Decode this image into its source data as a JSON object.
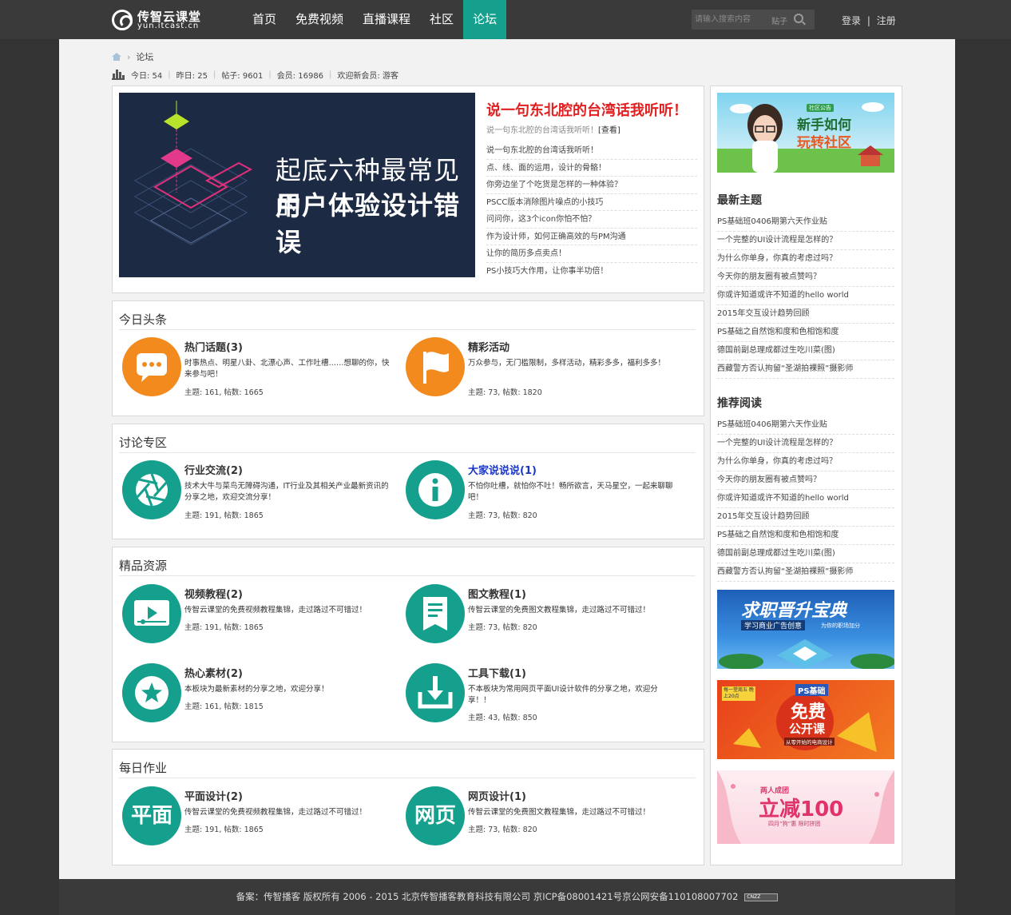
{
  "header": {
    "logo_cn": "传智云课堂",
    "logo_en": "yun.itcast.cn",
    "nav": [
      "首页",
      "免费视频",
      "直播课程",
      "社区",
      "论坛"
    ],
    "search_placeholder": "请输入搜索内容",
    "search_category": "贴子",
    "login": "登录",
    "divider": "|",
    "register": "注册"
  },
  "breadcrumb": {
    "current": "论坛"
  },
  "stats": {
    "today": "今日: 54",
    "yesterday": "昨日: 25",
    "posts": "帖子: 9601",
    "members": "会员: 16986",
    "welcome": "欢迎新会员: 游客"
  },
  "featured": {
    "banner_line1": "起底六种最常见的",
    "banner_line2": "用户体验设计错误",
    "headline": "说一句东北腔的台湾话我听听！",
    "subline": "说一句东北腔的台湾话我听听！",
    "subline_link": "[查看]",
    "items": [
      "说一句东北腔的台湾话我听听！",
      "点、线、面的运用，设计的骨骼！",
      "你旁边坐了个吃货是怎样的一种体验？",
      "PSCC版本消除图片噪点的小技巧",
      "问问你，这3个icon你怕不怕？",
      "作为设计师，如何正确高效的与PM沟通",
      "让你的简历多点卖点！",
      "PS小技巧大作用，让你事半功倍！"
    ]
  },
  "sections": {
    "headlines": {
      "title": "今日头条",
      "forums": [
        {
          "name": "热门话题(3)",
          "desc": "时事热点、明星八卦、北漂心声、工作吐槽……想聊的你，快来参与吧！",
          "count": "主题: 161, 帖数: 1665"
        },
        {
          "name": "精彩活动",
          "desc": "万众参与，无门槛限制，多样活动，精彩多多，福利多多！",
          "count": "主题: 73, 帖数: 1820"
        }
      ]
    },
    "discussion": {
      "title": "讨论专区",
      "forums": [
        {
          "name": "行业交流(2)",
          "desc": "技术大牛与菜鸟无障碍沟通，IT行业及其相关产业最新资讯的分享之地，欢迎交流分享！",
          "count": "主题: 191, 帖数: 1865"
        },
        {
          "name": "大家说说说(1)",
          "desc": "不怕你吐槽，就怕你不吐！畅所欲言，天马星空，一起来聊聊吧！",
          "count": "主题: 73, 帖数: 820"
        }
      ]
    },
    "resources": {
      "title": "精品资源",
      "forums": [
        {
          "name": "视频教程(2)",
          "desc": "传智云课堂的免费视频教程集锦，走过路过不可错过！",
          "count": "主题: 191, 帖数: 1865"
        },
        {
          "name": "图文教程(1)",
          "desc": "传智云课堂的免费图文教程集锦，走过路过不可错过！",
          "count": "主题: 73, 帖数: 820"
        },
        {
          "name": "热心素材(2)",
          "desc": "本板块为最新素材的分享之地，欢迎分享！",
          "count": "主题: 161, 帖数: 1815"
        },
        {
          "name": "工具下载(1)",
          "desc": "不本板块为常用网页平面UI设计软件的分享之地，欢迎分享！！",
          "count": "主题: 43, 帖数: 850"
        }
      ]
    },
    "homework": {
      "title": "每日作业",
      "forums": [
        {
          "name": "平面设计(2)",
          "icon_text": "平面",
          "desc": "传智云课堂的免费视频教程集锦，走过路过不可错过！",
          "count": "主题: 191, 帖数: 1865"
        },
        {
          "name": "网页设计(1)",
          "icon_text": "网页",
          "desc": "传智云课堂的免费图文教程集锦，走过路过不可错过！",
          "count": "主题: 73, 帖数: 820"
        }
      ]
    }
  },
  "sidebar": {
    "promo_top_line1": "新手如何",
    "promo_top_line2": "玩转社区",
    "promo_top_tag": "社区公告",
    "latest_title": "最新主题",
    "latest": [
      "PS基础班0406期第六天作业贴",
      "一个完整的UI设计流程是怎样的？",
      "为什么你单身，你真的考虑过吗？",
      "今天你的朋友圈有被点赞吗？",
      "你或许知道或许不知道的hello world",
      "2015年交互设计趋势回顾",
      "PS基础之自然饱和度和色相饱和度",
      "德国前副总理成都过生吃川菜(图)",
      "西藏警方否认拘留“圣湖拍裸照”摄影师"
    ],
    "recommend_title": "推荐阅读",
    "recommend": [
      "PS基础班0406期第六天作业贴",
      "一个完整的UI设计流程是怎样的？",
      "为什么你单身，你真的考虑过吗？",
      "今天你的朋友圈有被点赞吗？",
      "你或许知道或许不知道的hello world",
      "2015年交互设计趋势回顾",
      "PS基础之自然饱和度和色相饱和度",
      "德国前副总理成都过生吃川菜(图)",
      "西藏警方否认拘留“圣湖拍裸照”摄影师"
    ],
    "ad1_title": "求职晋升宝典",
    "ad1_sub": "学习商业广告创意",
    "ad1_sub2": "为你的职场加分",
    "ad2_badge": "PS基础",
    "ad2_title1": "免费",
    "ad2_title2": "公开课",
    "ad2_sub": "从零开始的电商设计",
    "ad2_tag": "每一堂周五 晚上20点",
    "ad3_small": "两人成团",
    "ad3_title": "立减100",
    "ad3_sub": "四月“狗”惠 限时拼团"
  },
  "footer": {
    "text": "备案：传智播客  版权所有 2006 - 2015 北京传智播客教育科技有限公司   京ICP备08001421号京公网安备110108007702",
    "badge": "CNZZ"
  },
  "colors": {
    "teal": "#14a08c",
    "orange": "#f28a1e",
    "red_headline": "#e02020",
    "topbar": "#3a3a3a"
  }
}
